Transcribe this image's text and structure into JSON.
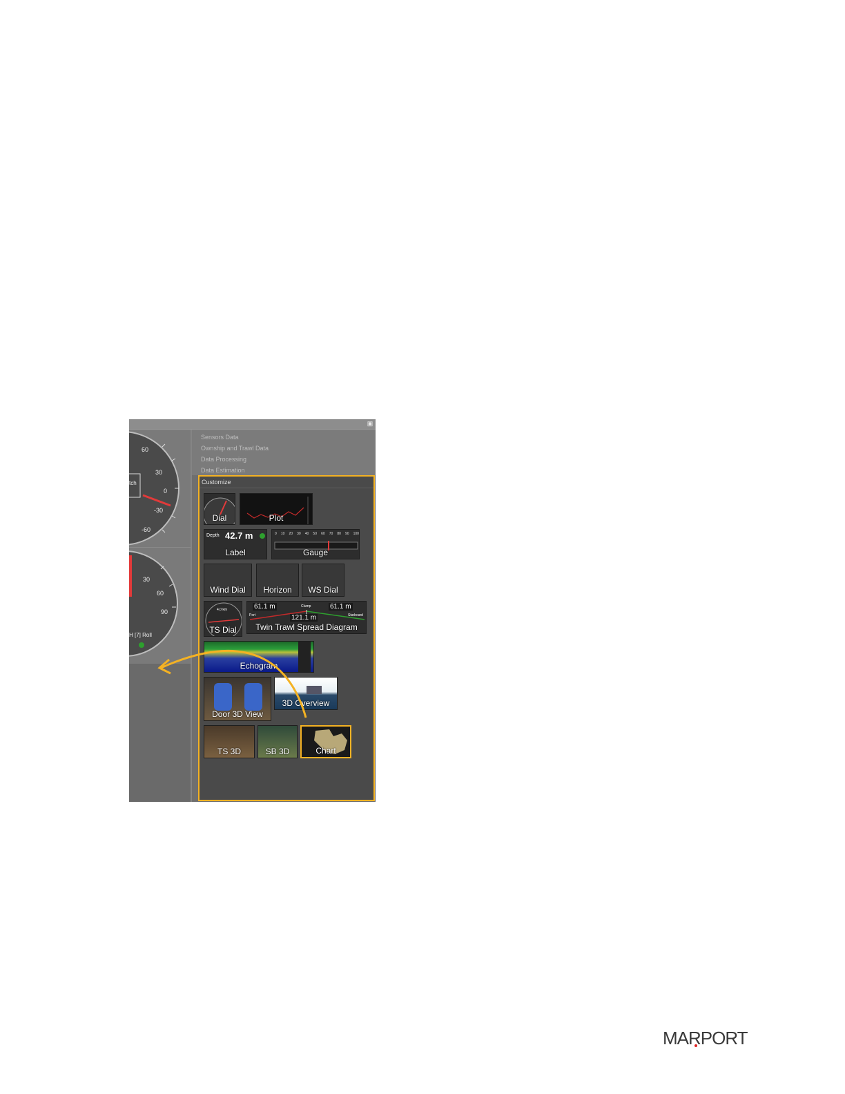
{
  "left_pane": {
    "gauge1_ticks": [
      "60",
      "30",
      "0",
      "-30",
      "-60"
    ],
    "gauge1_label": "tch",
    "gauge2_ticks": [
      "30",
      "60",
      "90"
    ],
    "gauge2_label": "H [7] Roll"
  },
  "menu": {
    "items": [
      "Sensors Data",
      "Ownship and Trawl Data",
      "Data Processing",
      "Data Estimation"
    ]
  },
  "customize": {
    "title": "Customize",
    "tiles": {
      "dial": "Dial",
      "plot": "Plot",
      "label": "Label",
      "gauge": "Gauge",
      "wind_dial": "Wind Dial",
      "horizon": "Horizon",
      "ws_dial": "WS Dial",
      "ts_dial": "TS Dial",
      "twin_trawl": "Twin Trawl Spread Diagram",
      "echogram": "Echogram",
      "door_3d": "Door 3D View",
      "overview_3d": "3D Overview",
      "ts_3d": "TS 3D",
      "sb_3d": "SB 3D",
      "chart": "Chart"
    },
    "label_preview": {
      "name": "Depth",
      "value": "42.7 m"
    },
    "gauge_ticks": [
      "0",
      "10",
      "20",
      "30",
      "40",
      "50",
      "60",
      "70",
      "80",
      "90",
      "100"
    ],
    "twin_trawl_preview": {
      "port_value": "61.1 m",
      "starboard_value": "61.1 m",
      "center_value": "121.1 m",
      "port_label": "Port",
      "clump_label": "Clump",
      "starboard_label": "Starboard"
    },
    "ts_dial_preview": "4.0 km"
  },
  "colors": {
    "highlight": "#f4b223",
    "panel_bg": "#4a4a4a"
  },
  "logo": {
    "text": "MARPORT"
  }
}
